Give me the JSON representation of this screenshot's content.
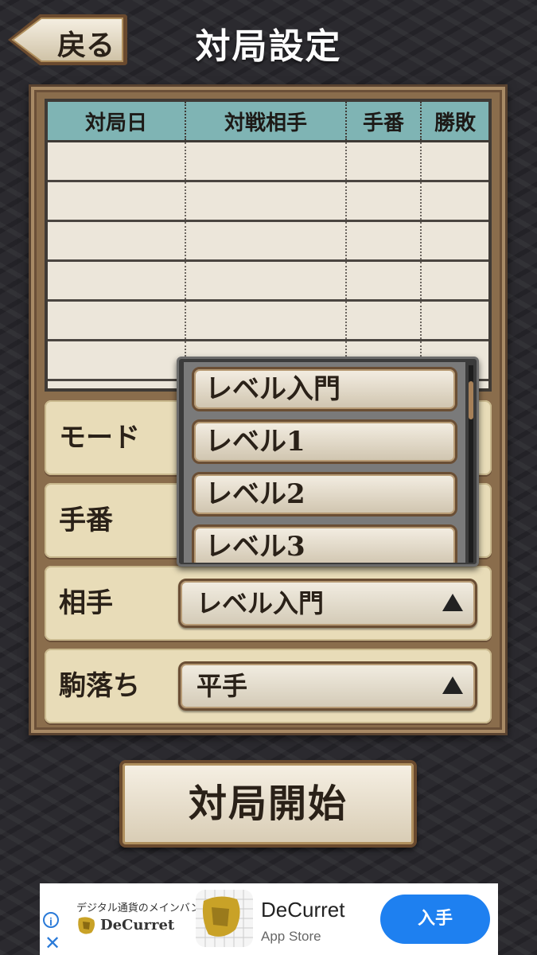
{
  "header": {
    "back_label": "戻る",
    "title": "対局設定"
  },
  "record_table": {
    "columns": [
      "対局日",
      "対戦相手",
      "手番",
      "勝敗"
    ],
    "rows": [
      [
        "",
        "",
        "",
        ""
      ],
      [
        "",
        "",
        "",
        ""
      ],
      [
        "",
        "",
        "",
        ""
      ],
      [
        "",
        "",
        "",
        ""
      ],
      [
        "",
        "",
        "",
        ""
      ],
      [
        "",
        "",
        "",
        ""
      ]
    ]
  },
  "settings": [
    {
      "label": "モード",
      "value": ""
    },
    {
      "label": "手番",
      "value": ""
    },
    {
      "label": "相手",
      "value": "レベル入門"
    },
    {
      "label": "駒落ち",
      "value": "平手"
    }
  ],
  "dropdown": {
    "options": [
      "レベル入門",
      "レベル1",
      "レベル2",
      "レベル3"
    ]
  },
  "start_button": {
    "label": "対局開始"
  },
  "ad": {
    "tagline": "デジタル通貨のメインバンク",
    "wordmark": "DeCurret",
    "app_name": "DeCurret",
    "store": "App Store",
    "cta": "入手",
    "info_icon": "i",
    "close_icon": "✕"
  },
  "colors": {
    "table_header": "#7fb4b4",
    "panel": "#8a6d4c",
    "cta_blue": "#1e80f0"
  }
}
